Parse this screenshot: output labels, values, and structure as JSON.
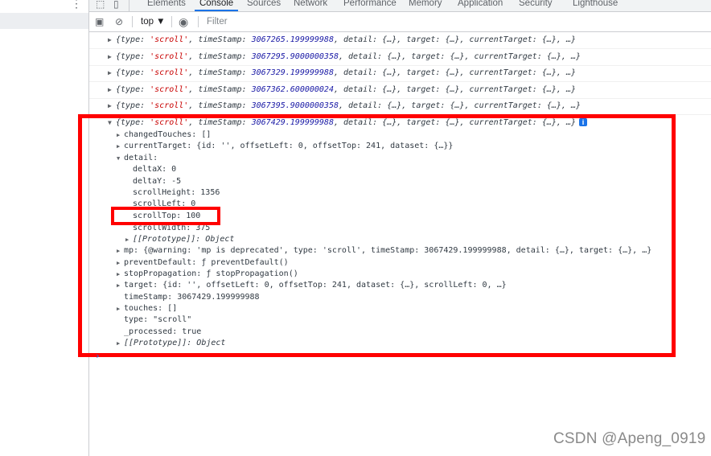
{
  "devtools": {
    "tabs": [
      {
        "label": "Elements"
      },
      {
        "label": "Console"
      },
      {
        "label": "Sources"
      },
      {
        "label": "Network"
      },
      {
        "label": "Performance"
      },
      {
        "label": "Memory"
      },
      {
        "label": "Application"
      },
      {
        "label": "Security"
      },
      {
        "label": "Lighthouse"
      }
    ],
    "active_tab": "Console",
    "toolbar": {
      "context": "top ▼",
      "filter_placeholder": "Filter"
    }
  },
  "console": {
    "collapsed_rows": [
      {
        "timestamp": "3067265.199999988"
      },
      {
        "timestamp": "3067295.9000000358"
      },
      {
        "timestamp": "3067329.199999988"
      },
      {
        "timestamp": "3067362.600000024"
      },
      {
        "timestamp": "3067395.9000000358"
      }
    ],
    "row_template": {
      "prefix": "{type: ",
      "type_value": "'scroll'",
      "mid": ", timeStamp: ",
      "suffix": ", detail: {…}, target: {…}, currentTarget: {…}, …}"
    },
    "expanded": {
      "header_timestamp": "3067429.199999988",
      "lines": {
        "changedTouches": "changedTouches: []",
        "currentTarget": "currentTarget: {id: '', offsetLeft: 0, offsetTop: 241, dataset: {…}}",
        "detail": "detail:",
        "deltaX": "deltaX: 0",
        "deltaY": "deltaY: -5",
        "scrollHeight": "scrollHeight: 1356",
        "scrollLeft": "scrollLeft: 0",
        "scrollTop": "scrollTop: 100",
        "scrollWidth": "scrollWidth: 375",
        "detail_proto": "[[Prototype]]: Object",
        "mp": "mp: {@warning: 'mp is deprecated', type: 'scroll', timeStamp: 3067429.199999988, detail: {…}, target: {…}, …}",
        "preventDefault": "preventDefault: ƒ preventDefault()",
        "stopPropagation": "stopPropagation: ƒ stopPropagation()",
        "target": "target: {id: '', offsetLeft: 0, offsetTop: 241, dataset: {…}, scrollLeft: 0, …}",
        "timeStamp": "timeStamp: 3067429.199999988",
        "touches": "touches: []",
        "type": "type: \"scroll\"",
        "processed": "_processed: true",
        "proto": "[[Prototype]]: Object"
      }
    },
    "prompt": "›"
  },
  "watermark": "CSDN @Apeng_0919",
  "colors": {
    "highlight": "#ff0000",
    "accent": "#1a73e8"
  }
}
